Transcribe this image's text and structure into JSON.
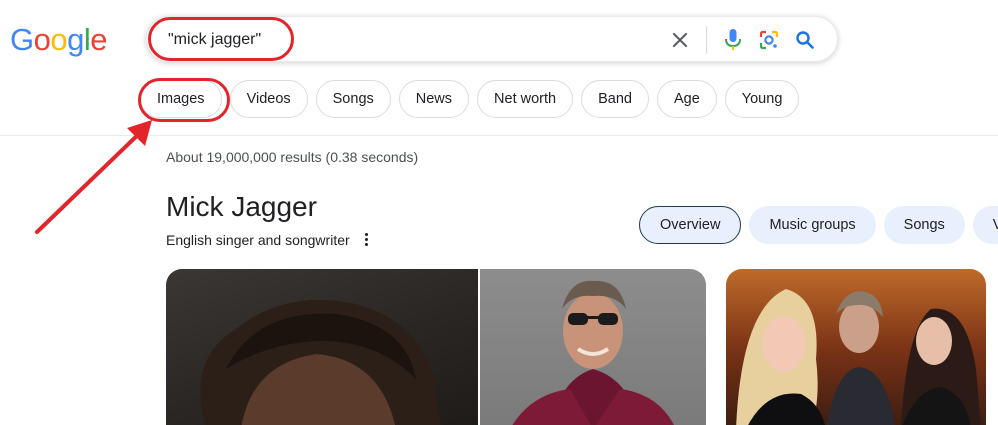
{
  "logo": {
    "letters": [
      "G",
      "o",
      "o",
      "g",
      "l",
      "e"
    ],
    "colors": [
      "#4285F4",
      "#EA4335",
      "#FBBC05",
      "#4285F4",
      "#34A853",
      "#EA4335"
    ]
  },
  "search": {
    "query": "\"mick jagger\"",
    "icons": [
      "clear-icon",
      "microphone-icon",
      "lens-icon",
      "search-icon"
    ]
  },
  "chips": [
    "Images",
    "Videos",
    "Songs",
    "News",
    "Net worth",
    "Band",
    "Age",
    "Young"
  ],
  "results": {
    "stats": "About 19,000,000 results (0.38 seconds)"
  },
  "knowledge_panel": {
    "title": "Mick Jagger",
    "subtitle": "English singer and songwriter",
    "tabs": [
      "Overview",
      "Music groups",
      "Songs",
      "Vi"
    ]
  },
  "annotation_color": "#e3242b"
}
